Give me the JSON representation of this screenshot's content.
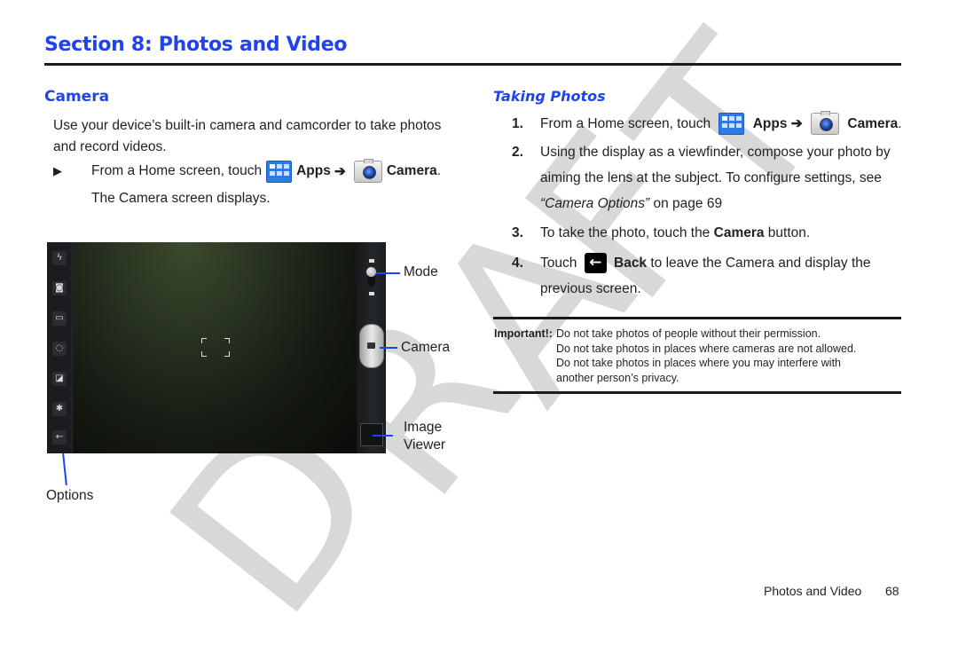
{
  "watermark": {
    "letters": [
      "D",
      "R",
      "A",
      "F",
      "T"
    ],
    "color": "#d8d8d8"
  },
  "header": {
    "section_title": "Section 8: Photos and Video",
    "accent_color": "#1f44ee"
  },
  "left": {
    "heading": "Camera",
    "intro": "Use your device’s built-in camera and camcorder to take photos and record videos.",
    "bullet": {
      "marker": "▶",
      "prefix": "From a Home screen, touch",
      "apps_icon": "apps-grid-icon",
      "apps_label": "Apps",
      "arrow": "➔",
      "camera_icon": "camera-app-icon",
      "camera_label": "Camera",
      "suffix": "."
    },
    "result": "The Camera screen displays.",
    "screenshot": {
      "option_icons": [
        "flash-icon",
        "shooting-mode-icon",
        "scene-mode-icon",
        "timer-icon",
        "exposure-icon",
        "settings-gear-icon",
        "back-arrow-icon"
      ],
      "option_glyphs": [
        "ϟ",
        "◙",
        "▭",
        "◌",
        "◪",
        "✱",
        "←"
      ],
      "callouts": {
        "mode": "Mode",
        "camera": "Camera",
        "image_viewer_line1": "Image",
        "image_viewer_line2": "Viewer",
        "options": "Options"
      }
    }
  },
  "right": {
    "heading": "Taking Photos",
    "steps": [
      {
        "num": "1.",
        "prefix": "From a Home screen, touch",
        "apps_label": "Apps",
        "arrow": "➔",
        "camera_label": "Camera",
        "suffix": "."
      },
      {
        "num": "2.",
        "text": "Using the display as a viewfinder, compose your photo by aiming the lens at the subject. To configure settings, see",
        "link": "“Camera Options”",
        "link_suffix": " on page 69"
      },
      {
        "num": "3.",
        "prefix": "To take the photo, touch the",
        "bold": "Camera",
        "suffix": " button."
      },
      {
        "num": "4.",
        "prefix": "Touch",
        "back_glyph": "←",
        "bold": "Back",
        "suffix": " to leave the Camera and display the previous screen."
      }
    ],
    "note": {
      "label": "Important!:",
      "lines": [
        "Do not take photos of people without their permission.",
        "Do not take photos in places where cameras are not allowed.",
        "Do not take photos in places where you may interfere with",
        "another person’s privacy."
      ]
    }
  },
  "footer": {
    "section_name": "Photos and Video",
    "page_number": "68"
  }
}
